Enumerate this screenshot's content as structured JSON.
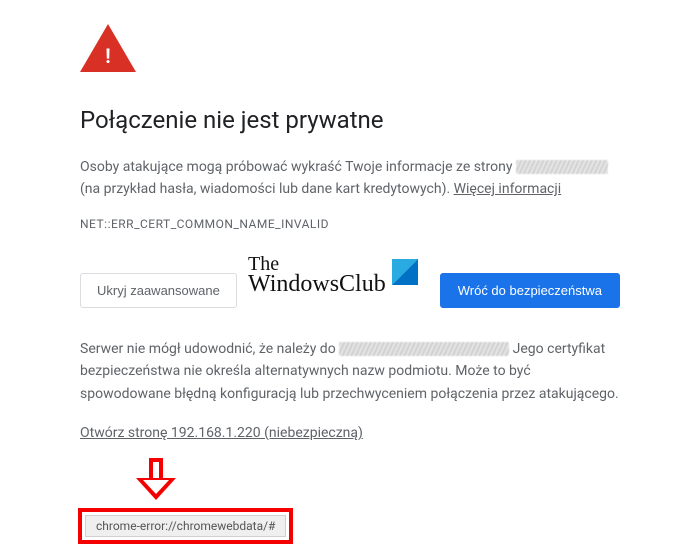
{
  "heading": "Połączenie nie jest prywatne",
  "body1_a": "Osoby atakujące mogą próbować wykraść Twoje informacje ze strony ",
  "body1_b": " (na przykład hasła, wiadomości lub dane kart kredytowych). ",
  "more_info": "Więcej informacji",
  "error_code": "NET::ERR_CERT_COMMON_NAME_INVALID",
  "btn_hide_advanced": "Ukryj zaawansowane",
  "btn_back_to_safety": "Wróć do bezpieczeństwa",
  "adv1_a": "Serwer nie mógł udowodnić, że należy do ",
  "adv1_b": "Jego certyfikat bezpieczeństwa nie określa alternatywnych nazw podmiotu. Może to być spowodowane błędną konfiguracją lub przechwyceniem połączenia przez atakującego.",
  "proceed_link": "Otwórz stronę 192.168.1.220 (niebezpieczną)",
  "status_url": "chrome-error://chromewebdata/#",
  "watermark_line1": "The",
  "watermark_line2": "WindowsClub"
}
